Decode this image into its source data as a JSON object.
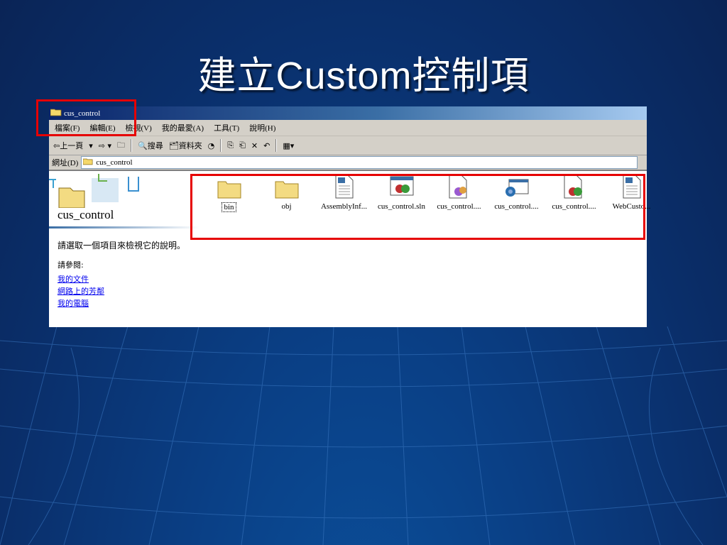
{
  "slide": {
    "title": "建立Custom控制項"
  },
  "window": {
    "title": "cus_control",
    "menu": [
      "檔案(F)",
      "編輯(E)",
      "檢視(V)",
      "我的最愛(A)",
      "工具(T)",
      "說明(H)"
    ],
    "toolbar": {
      "back": "⇦上一頁",
      "search": "搜尋",
      "folders": "資料夾"
    },
    "address": {
      "label": "網址(D)",
      "value": "cus_control"
    },
    "left_pane": {
      "folder_name": "cus_control",
      "description": "請選取一個項目來檢視它的說明。",
      "see_also": "請參閱:",
      "links": [
        "我的文件",
        "網路上的芳鄰",
        "我的電腦"
      ]
    },
    "files": [
      {
        "name": "bin",
        "icon": "folder-icon"
      },
      {
        "name": "obj",
        "icon": "folder-icon"
      },
      {
        "name": "AssemblyInf...",
        "icon": "vb-file-icon"
      },
      {
        "name": "cus_control.sln",
        "icon": "solution-icon"
      },
      {
        "name": "cus_control....",
        "icon": "project-file-icon"
      },
      {
        "name": "cus_control....",
        "icon": "vb-window-icon"
      },
      {
        "name": "cus_control....",
        "icon": "solution-doc-icon"
      },
      {
        "name": "WebCusto...",
        "icon": "vb-file-icon"
      }
    ]
  },
  "colors": {
    "highlight": "#e60000",
    "titlebar": "#0a246a"
  }
}
